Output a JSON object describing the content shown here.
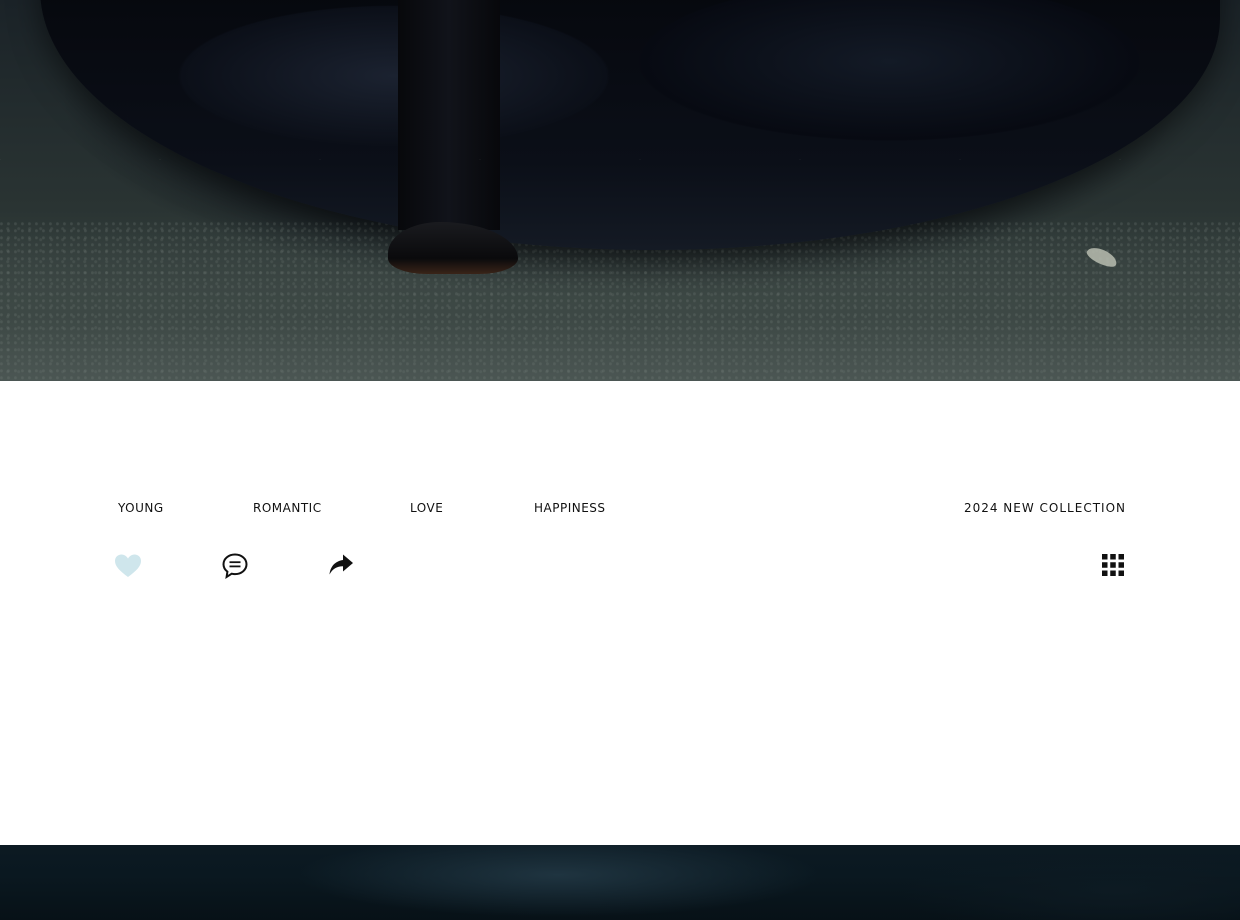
{
  "tags": {
    "young": "YOUNG",
    "romantic": "ROMANTIC",
    "love": "LOVE",
    "happiness": "HAPPINESS"
  },
  "collection_label": "2024 NEW COLLECTION",
  "actions": {
    "like_icon": "heart-icon",
    "comment_icon": "comment-icon",
    "share_icon": "share-icon",
    "menu_icon": "grid-icon"
  },
  "colors": {
    "heart": "#cfe6ec",
    "text": "#111111",
    "icon": "#111111"
  }
}
